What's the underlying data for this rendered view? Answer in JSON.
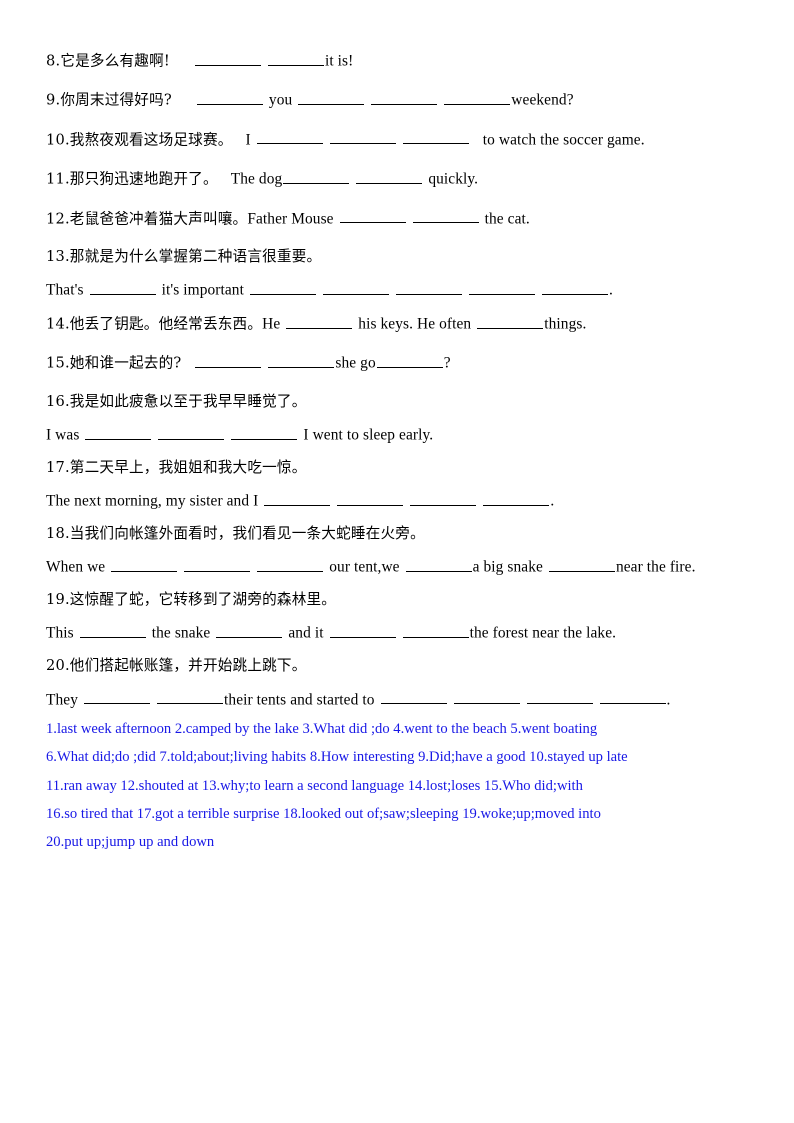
{
  "document": {
    "type": "fill-in-the-blank worksheet",
    "language": "Chinese-English translation exercise",
    "answer_key_color": "#1818e6",
    "text_color": "#000000",
    "background_color": "#ffffff"
  },
  "questions": [
    {
      "number": "8.",
      "prompt_cn": "它是多么有趣啊!",
      "answer_line_parts": [
        "",
        "",
        "it is!"
      ]
    },
    {
      "number": "9.",
      "prompt_cn": "你周末过得好吗?",
      "answer_line_parts": [
        "",
        "you",
        "",
        "",
        "weekend?"
      ]
    },
    {
      "number": "10.",
      "prompt_cn": "我熬夜观看这场足球赛。",
      "answer_line_parts": [
        "I",
        "",
        "",
        "",
        "to watch the soccer game."
      ]
    },
    {
      "number": "11.",
      "prompt_cn": "那只狗迅速地跑开了。",
      "answer_line_parts": [
        "The dog",
        "",
        "",
        "quickly."
      ]
    },
    {
      "number": "12.",
      "prompt_cn": "老鼠爸爸冲着猫大声叫嚷。",
      "answer_line_parts": [
        "Father Mouse",
        "",
        "",
        "the cat."
      ]
    },
    {
      "number": "13.",
      "prompt_cn": "那就是为什么掌握第二种语言很重要。",
      "sub_line_parts": [
        "That's",
        "",
        "it's important",
        "",
        "",
        "",
        "",
        "",
        "."
      ]
    },
    {
      "number": "14.",
      "prompt_cn": "他丢了钥匙。他经常丢东西。",
      "answer_line_parts": [
        "He",
        "",
        "his keys. He often",
        "",
        "things."
      ]
    },
    {
      "number": "15.",
      "prompt_cn": "她和谁一起去的?",
      "answer_line_parts": [
        "",
        "",
        "she go",
        "",
        "?"
      ]
    },
    {
      "number": "16.",
      "prompt_cn": "我是如此疲惫以至于我早早睡觉了。",
      "sub_line_parts": [
        "I was",
        "",
        "",
        "",
        "I went to sleep early."
      ]
    },
    {
      "number": "17.",
      "prompt_cn": "第二天早上，我姐姐和我大吃一惊。",
      "sub_line_parts": [
        "The next morning, my sister and I",
        "",
        "",
        "",
        "",
        "."
      ]
    },
    {
      "number": "18.",
      "prompt_cn": "当我们向帐篷外面看时，我们看见一条大蛇睡在火旁。",
      "sub_line_parts": [
        "When we",
        "",
        "",
        "",
        "our tent,we",
        "",
        "a big snake",
        "",
        "near the fire."
      ]
    },
    {
      "number": "19.",
      "prompt_cn": "这惊醒了蛇，它转移到了湖旁的森林里。",
      "sub_line_parts": [
        "This",
        "",
        "the snake",
        "",
        "and it",
        "",
        "",
        "the forest near the lake."
      ]
    },
    {
      "number": "20.",
      "prompt_cn": "他们搭起帐账篷，并开始跳上跳下。",
      "sub_line_parts": [
        "They",
        "",
        "",
        "their tents and started to",
        "",
        "",
        "",
        "",
        "."
      ]
    }
  ],
  "question_text": {
    "q8_cn": "8.它是多么有趣啊!",
    "q8_tail": "it is!",
    "q9_cn": "9.你周末过得好吗?",
    "q9_mid": "you",
    "q9_tail": "weekend?",
    "q10_cn": "10.我熬夜观看这场足球赛。",
    "q10_lead": "I",
    "q10_tail": "to watch the soccer game.",
    "q11_cn": "11.那只狗迅速地跑开了。",
    "q11_lead": "The dog",
    "q11_tail": "quickly.",
    "q12_cn": "12.老鼠爸爸冲着猫大声叫嚷。",
    "q12_lead": "Father Mouse",
    "q12_tail": "the cat.",
    "q13_cn": "13.那就是为什么掌握第二种语言很重要。",
    "q13_lead": "That's",
    "q13_mid": "it's important",
    "q13_tail": ".",
    "q14_cn": "14.他丢了钥匙。他经常丢东西。",
    "q14_lead": "He",
    "q14_mid": "his keys. He often",
    "q14_tail": "things.",
    "q15_cn": "15.她和谁一起去的?",
    "q15_mid": "she go",
    "q15_tail": "?",
    "q16_cn": "16.我是如此疲惫以至于我早早睡觉了。",
    "q16_lead": "I was",
    "q16_tail": "I went to sleep early.",
    "q17_cn": "17.第二天早上，我姐姐和我大吃一惊。",
    "q17_lead": "The next morning, my sister and I",
    "q17_tail": ".",
    "q18_cn": "18.当我们向帐篷外面看时，我们看见一条大蛇睡在火旁。",
    "q18_lead": "When we",
    "q18_mid1": "our tent,we",
    "q18_mid2": "a big snake",
    "q18_tail": "near the fire.",
    "q19_cn": "19.这惊醒了蛇，它转移到了湖旁的森林里。",
    "q19_lead": "This",
    "q19_mid1": "the snake",
    "q19_mid2": "and it",
    "q19_tail": "the forest near the lake.",
    "q20_cn": "20.他们搭起帐账篷，并开始跳上跳下。",
    "q20_lead": "They",
    "q20_mid": "their tents and started to",
    "q20_tail": "."
  },
  "answer_key": {
    "lines": [
      "1.last week afternoon    2.camped by the lake    3.What did ;do    4.went to the beach    5.went boating",
      "6.What did;do ;did 7.told;about;living habits    8.How interesting 9.Did;have a good 10.stayed up late",
      "11.ran away 12.shouted at 13.why;to learn a second language 14.lost;loses    15.Who did;with",
      "16.so tired that    17.got a terrible surprise 18.looked out of;saw;sleeping 19.woke;up;moved into",
      "20.put up;jump up and down"
    ],
    "items": [
      {
        "number": "1.",
        "answer": "last week afternoon"
      },
      {
        "number": "2.",
        "answer": "camped by the lake"
      },
      {
        "number": "3.",
        "answer": "What did ;do"
      },
      {
        "number": "4.",
        "answer": "went to the beach"
      },
      {
        "number": "5.",
        "answer": "went boating"
      },
      {
        "number": "6.",
        "answer": "What did;do ;did"
      },
      {
        "number": "7.",
        "answer": "told;about;living habits"
      },
      {
        "number": "8.",
        "answer": "How interesting"
      },
      {
        "number": "9.",
        "answer": "Did;have a good"
      },
      {
        "number": "10.",
        "answer": "stayed up late"
      },
      {
        "number": "11.",
        "answer": "ran away"
      },
      {
        "number": "12.",
        "answer": "shouted at"
      },
      {
        "number": "13.",
        "answer": "why;to learn a second language"
      },
      {
        "number": "14.",
        "answer": "lost;loses"
      },
      {
        "number": "15.",
        "answer": "Who did;with"
      },
      {
        "number": "16.",
        "answer": "so tired that"
      },
      {
        "number": "17.",
        "answer": "got a terrible surprise"
      },
      {
        "number": "18.",
        "answer": "looked out of;saw;sleeping"
      },
      {
        "number": "19.",
        "answer": "woke;up;moved into"
      },
      {
        "number": "20.",
        "answer": "put up;jump up and down"
      }
    ]
  }
}
